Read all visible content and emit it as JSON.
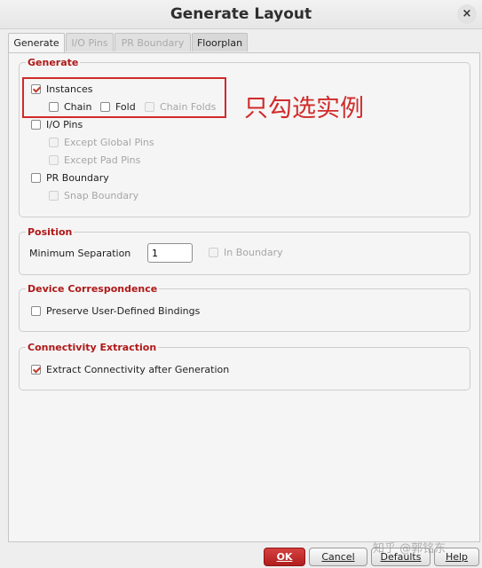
{
  "window": {
    "title": "Generate Layout",
    "close_glyph": "×"
  },
  "tabs": [
    {
      "label": "Generate",
      "active": true
    },
    {
      "label": "I/O Pins",
      "active": false
    },
    {
      "label": "PR Boundary",
      "active": false
    },
    {
      "label": "Floorplan",
      "active": false
    }
  ],
  "generate": {
    "legend": "Generate",
    "instances": {
      "label": "Instances",
      "checked": true
    },
    "chain": {
      "label": "Chain",
      "checked": false
    },
    "fold": {
      "label": "Fold",
      "checked": false
    },
    "chain_folds": {
      "label": "Chain Folds",
      "checked": false,
      "disabled": true
    },
    "io_pins": {
      "label": "I/O Pins",
      "checked": false
    },
    "except_global_pins": {
      "label": "Except Global Pins",
      "disabled": true
    },
    "except_pad_pins": {
      "label": "Except Pad Pins",
      "disabled": true
    },
    "pr_boundary": {
      "label": "PR Boundary",
      "checked": false
    },
    "snap_boundary": {
      "label": "Snap Boundary",
      "disabled": true
    }
  },
  "position": {
    "legend": "Position",
    "min_sep_label": "Minimum Separation",
    "min_sep_value": "1",
    "in_boundary": {
      "label": "In Boundary",
      "disabled": true
    }
  },
  "device_correspondence": {
    "legend": "Device Correspondence",
    "preserve": {
      "label": "Preserve User-Defined Bindings",
      "checked": false
    }
  },
  "connectivity": {
    "legend": "Connectivity Extraction",
    "extract": {
      "label": "Extract Connectivity after Generation",
      "checked": true
    }
  },
  "annotation": {
    "text": "只勾选实例"
  },
  "buttons": {
    "ok": "OK",
    "cancel": "Cancel",
    "defaults": "Defaults",
    "help": "Help"
  },
  "watermark": "知乎 @郭铭东",
  "colors": {
    "accent": "#b01818",
    "highlight": "#d12a2a"
  }
}
